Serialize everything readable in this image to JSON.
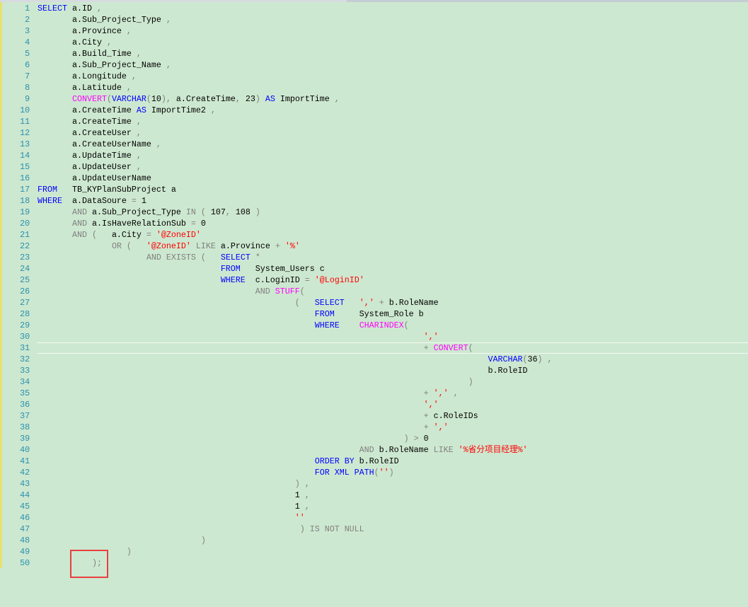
{
  "editor": {
    "current_line": 31,
    "colors": {
      "keyword": "#0000ff",
      "function": "#ff00ff",
      "string": "#ff0000",
      "operator": "#808080",
      "line_number": "#2b91af",
      "background": "#cde8d0",
      "highlight_box": "#e84040"
    },
    "highlighted_line": 50,
    "lines": [
      [
        [
          "kw",
          "SELECT"
        ],
        [
          "id",
          " a.ID "
        ],
        [
          "op",
          ","
        ]
      ],
      [
        [
          "id",
          "       a.Sub_Project_Type "
        ],
        [
          "op",
          ","
        ]
      ],
      [
        [
          "id",
          "       a.Province "
        ],
        [
          "op",
          ","
        ]
      ],
      [
        [
          "id",
          "       a.City "
        ],
        [
          "op",
          ","
        ]
      ],
      [
        [
          "id",
          "       a.Build_Time "
        ],
        [
          "op",
          ","
        ]
      ],
      [
        [
          "id",
          "       a.Sub_Project_Name "
        ],
        [
          "op",
          ","
        ]
      ],
      [
        [
          "id",
          "       a.Longitude "
        ],
        [
          "op",
          ","
        ]
      ],
      [
        [
          "id",
          "       a.Latitude "
        ],
        [
          "op",
          ","
        ]
      ],
      [
        [
          "id",
          "       "
        ],
        [
          "fn",
          "CONVERT"
        ],
        [
          "op",
          "("
        ],
        [
          "kw",
          "VARCHAR"
        ],
        [
          "op",
          "("
        ],
        [
          "id",
          "10"
        ],
        [
          "op",
          ")"
        ],
        [
          "op",
          ","
        ],
        [
          "id",
          " a.CreateTime"
        ],
        [
          "op",
          ","
        ],
        [
          "id",
          " 23"
        ],
        [
          "op",
          ")"
        ],
        [
          "id",
          " "
        ],
        [
          "kw",
          "AS"
        ],
        [
          "id",
          " ImportTime "
        ],
        [
          "op",
          ","
        ]
      ],
      [
        [
          "id",
          "       a.CreateTime "
        ],
        [
          "kw",
          "AS"
        ],
        [
          "id",
          " ImportTime2 "
        ],
        [
          "op",
          ","
        ]
      ],
      [
        [
          "id",
          "       a.CreateTime "
        ],
        [
          "op",
          ","
        ]
      ],
      [
        [
          "id",
          "       a.CreateUser "
        ],
        [
          "op",
          ","
        ]
      ],
      [
        [
          "id",
          "       a.CreateUserName "
        ],
        [
          "op",
          ","
        ]
      ],
      [
        [
          "id",
          "       a.UpdateTime "
        ],
        [
          "op",
          ","
        ]
      ],
      [
        [
          "id",
          "       a.UpdateUser "
        ],
        [
          "op",
          ","
        ]
      ],
      [
        [
          "id",
          "       a.UpdateUserName"
        ]
      ],
      [
        [
          "kw",
          "FROM"
        ],
        [
          "id",
          "   TB_KYPlanSubProject a"
        ]
      ],
      [
        [
          "kw",
          "WHERE"
        ],
        [
          "id",
          "  a.DataSoure "
        ],
        [
          "op",
          "="
        ],
        [
          "id",
          " 1"
        ]
      ],
      [
        [
          "id",
          "       "
        ],
        [
          "op",
          "AND"
        ],
        [
          "id",
          " a.Sub_Project_Type "
        ],
        [
          "op",
          "IN"
        ],
        [
          "id",
          " "
        ],
        [
          "op",
          "("
        ],
        [
          "id",
          " 107"
        ],
        [
          "op",
          ","
        ],
        [
          "id",
          " 108 "
        ],
        [
          "op",
          ")"
        ]
      ],
      [
        [
          "id",
          "       "
        ],
        [
          "op",
          "AND"
        ],
        [
          "id",
          " a.IsHaveRelationSub "
        ],
        [
          "op",
          "="
        ],
        [
          "id",
          " 0"
        ]
      ],
      [
        [
          "id",
          "       "
        ],
        [
          "op",
          "AND ("
        ],
        [
          "id",
          "   a.City "
        ],
        [
          "op",
          "="
        ],
        [
          "id",
          " "
        ],
        [
          "str",
          "'@ZoneID'"
        ]
      ],
      [
        [
          "id",
          "               "
        ],
        [
          "op",
          "OR ("
        ],
        [
          "id",
          "   "
        ],
        [
          "str",
          "'@ZoneID'"
        ],
        [
          "id",
          " "
        ],
        [
          "op",
          "LIKE"
        ],
        [
          "id",
          " a.Province "
        ],
        [
          "op",
          "+"
        ],
        [
          "id",
          " "
        ],
        [
          "str",
          "'%'"
        ]
      ],
      [
        [
          "id",
          "                      "
        ],
        [
          "op",
          "AND EXISTS ("
        ],
        [
          "id",
          "   "
        ],
        [
          "kw",
          "SELECT"
        ],
        [
          "id",
          " "
        ],
        [
          "op",
          "*"
        ]
      ],
      [
        [
          "id",
          "                                     "
        ],
        [
          "kw",
          "FROM"
        ],
        [
          "id",
          "   System_Users c"
        ]
      ],
      [
        [
          "id",
          "                                     "
        ],
        [
          "kw",
          "WHERE"
        ],
        [
          "id",
          "  c.LoginID "
        ],
        [
          "op",
          "="
        ],
        [
          "id",
          " "
        ],
        [
          "str",
          "'@LoginID'"
        ]
      ],
      [
        [
          "id",
          "                                            "
        ],
        [
          "op",
          "AND"
        ],
        [
          "id",
          " "
        ],
        [
          "fn",
          "STUFF"
        ],
        [
          "op",
          "("
        ]
      ],
      [
        [
          "id",
          "                                                    "
        ],
        [
          "op",
          "("
        ],
        [
          "id",
          "   "
        ],
        [
          "kw",
          "SELECT"
        ],
        [
          "id",
          "   "
        ],
        [
          "str",
          "','"
        ],
        [
          "id",
          " "
        ],
        [
          "op",
          "+"
        ],
        [
          "id",
          " b.RoleName"
        ]
      ],
      [
        [
          "id",
          "                                                        "
        ],
        [
          "kw",
          "FROM"
        ],
        [
          "id",
          "     System_Role b"
        ]
      ],
      [
        [
          "id",
          "                                                        "
        ],
        [
          "kw",
          "WHERE"
        ],
        [
          "id",
          "    "
        ],
        [
          "fn",
          "CHARINDEX"
        ],
        [
          "op",
          "("
        ]
      ],
      [
        [
          "id",
          "                                                                              "
        ],
        [
          "str",
          "','"
        ]
      ],
      [
        [
          "id",
          "                                                                              "
        ],
        [
          "op",
          "+"
        ],
        [
          "id",
          " "
        ],
        [
          "fn",
          "CONVERT"
        ],
        [
          "op",
          "("
        ]
      ],
      [
        [
          "id",
          "                                                                                           "
        ],
        [
          "kw",
          "VARCHAR"
        ],
        [
          "op",
          "("
        ],
        [
          "id",
          "36"
        ],
        [
          "op",
          ")"
        ],
        [
          "id",
          " "
        ],
        [
          "op",
          ","
        ]
      ],
      [
        [
          "id",
          "                                                                                           b.RoleID"
        ]
      ],
      [
        [
          "id",
          "                                                                                       "
        ],
        [
          "op",
          ")"
        ]
      ],
      [
        [
          "id",
          "                                                                              "
        ],
        [
          "op",
          "+"
        ],
        [
          "id",
          " "
        ],
        [
          "str",
          "','"
        ],
        [
          "id",
          " "
        ],
        [
          "op",
          ","
        ]
      ],
      [
        [
          "id",
          "                                                                              "
        ],
        [
          "str",
          "','"
        ]
      ],
      [
        [
          "id",
          "                                                                              "
        ],
        [
          "op",
          "+"
        ],
        [
          "id",
          " c.RoleIDs"
        ]
      ],
      [
        [
          "id",
          "                                                                              "
        ],
        [
          "op",
          "+"
        ],
        [
          "id",
          " "
        ],
        [
          "str",
          "','"
        ]
      ],
      [
        [
          "id",
          "                                                                          "
        ],
        [
          "op",
          ")"
        ],
        [
          "id",
          " "
        ],
        [
          "op",
          ">"
        ],
        [
          "id",
          " 0"
        ]
      ],
      [
        [
          "id",
          "                                                                 "
        ],
        [
          "op",
          "AND"
        ],
        [
          "id",
          " b.RoleName "
        ],
        [
          "op",
          "LIKE"
        ],
        [
          "id",
          " "
        ],
        [
          "str",
          "'%省分项目经理%'"
        ]
      ],
      [
        [
          "id",
          "                                                        "
        ],
        [
          "kw",
          "ORDER BY"
        ],
        [
          "id",
          " b.RoleID"
        ]
      ],
      [
        [
          "id",
          "                                                        "
        ],
        [
          "kw",
          "FOR XML PATH"
        ],
        [
          "op",
          "("
        ],
        [
          "str",
          "''"
        ],
        [
          "op",
          ")"
        ]
      ],
      [
        [
          "id",
          "                                                    "
        ],
        [
          "op",
          ")"
        ],
        [
          "id",
          " "
        ],
        [
          "op",
          ","
        ]
      ],
      [
        [
          "id",
          "                                                    1 "
        ],
        [
          "op",
          ","
        ]
      ],
      [
        [
          "id",
          "                                                    1 "
        ],
        [
          "op",
          ","
        ]
      ],
      [
        [
          "id",
          "                                                    "
        ],
        [
          "str",
          "''"
        ]
      ],
      [
        [
          "id",
          "                                                     "
        ],
        [
          "op",
          ") IS NOT NULL"
        ]
      ],
      [
        [
          "id",
          "                                 "
        ],
        [
          "op",
          ")"
        ]
      ],
      [
        [
          "id",
          "                  "
        ],
        [
          "op",
          ")"
        ]
      ],
      [
        [
          "id",
          "           "
        ],
        [
          "op",
          ");"
        ]
      ]
    ]
  }
}
